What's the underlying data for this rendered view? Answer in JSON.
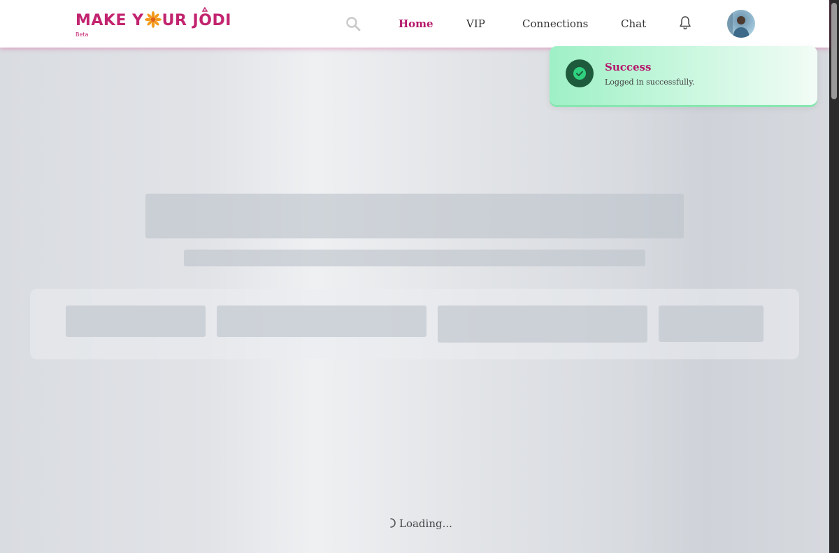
{
  "header": {
    "logo": {
      "part1": "MAKE Y",
      "part2": "UR J",
      "part3": "DI",
      "badge": "Beta"
    },
    "nav": [
      {
        "label": "Home",
        "active": true
      },
      {
        "label": "VIP",
        "active": false
      },
      {
        "label": "Connections",
        "active": false
      },
      {
        "label": "Chat",
        "active": false
      }
    ],
    "icons": {
      "search": "search-icon",
      "notifications": "bell-icon",
      "profile": "avatar"
    }
  },
  "toast": {
    "title": "Success",
    "message": "Logged in successfully.",
    "icon": "check-circle-icon",
    "accent": "#2fd17f"
  },
  "main": {
    "loading_text": "Loading...",
    "state": "skeleton-loading"
  },
  "colors": {
    "brand": "#c2246f",
    "active_nav": "#b5186a",
    "toast_bg": "#b8f3d4"
  }
}
